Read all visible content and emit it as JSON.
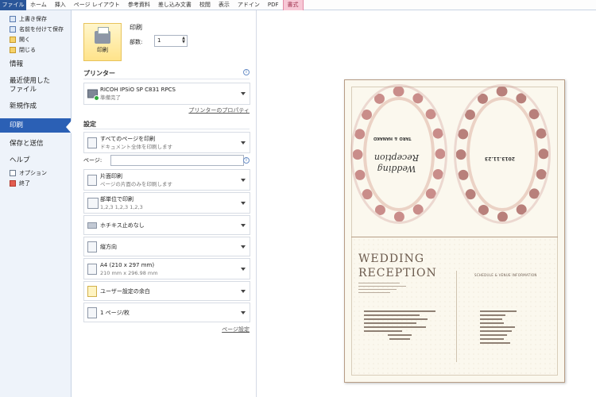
{
  "ribbon": {
    "tabs": [
      "ファイル",
      "ホーム",
      "挿入",
      "ページ レイアウト",
      "参考資料",
      "差し込み文書",
      "校閲",
      "表示",
      "アドイン",
      "PDF",
      "書式"
    ]
  },
  "nav": {
    "save": "上書き保存",
    "save_as": "名前を付けて保存",
    "open": "開く",
    "close": "閉じる",
    "info": "情報",
    "recent": "最近使用した",
    "recent2": "ファイル",
    "new": "新規作成",
    "print": "印刷",
    "save_send": "保存と送信",
    "help": "ヘルプ",
    "options": "オプション",
    "exit": "終了"
  },
  "print_panel": {
    "button_label": "印刷",
    "title": "印刷",
    "copies_label": "部数:",
    "copies_value": "1",
    "printer_heading": "プリンター",
    "printer_name": "RICOH IPSiO SP C831 RPCS",
    "printer_status": "準備完了",
    "printer_props": "プリンターのプロパティ",
    "settings_heading": "設定",
    "range": "すべてのページを印刷",
    "range_sub": "ドキュメント全体を印刷します",
    "pages_label": "ページ:",
    "sides": "片面印刷",
    "sides_sub": "ページの片面のみを印刷します",
    "collate": "部単位で印刷",
    "collate_sub": "1,2,3    1,2,3    1,2,3",
    "staple": "ホチキス止めなし",
    "orientation": "縦方向",
    "paper": "A4 (210 x 297 mm)",
    "paper_sub": "210 mm x 296.98 mm",
    "margins": "ユーザー設定の余白",
    "per_sheet": "1 ページ/枚",
    "page_setup": "ページ設定"
  },
  "preview": {
    "name_rotated": "TARO ＆ HANAKO",
    "wedding_script": "Wedding Reception",
    "date_rotated": "2013.11.23",
    "heading1": "WEDDING",
    "heading2": "RECEPTION",
    "schedule_heading": "SCHEDULE & VENUE INFORMATION"
  }
}
